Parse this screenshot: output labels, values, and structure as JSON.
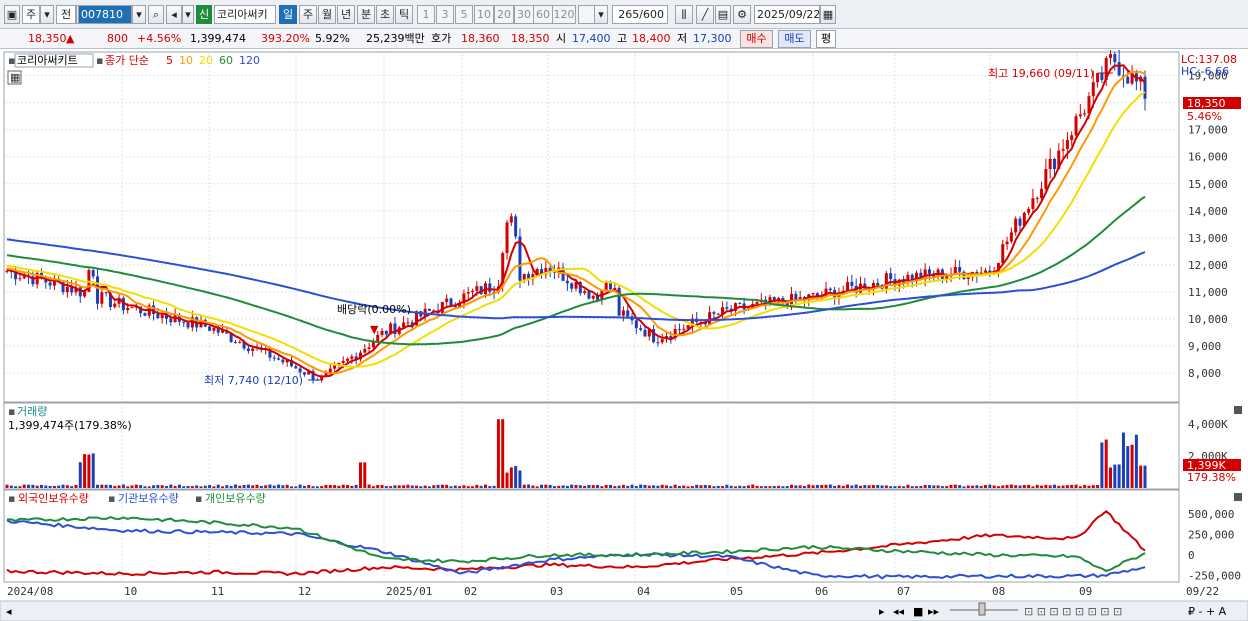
{
  "toolbar": {
    "mode": "주",
    "jeon": "전",
    "code": "007810",
    "badge": "신",
    "name": "코리아써키",
    "periods": [
      "일",
      "주",
      "월",
      "년",
      "분",
      "초",
      "틱"
    ],
    "minutes": [
      "1",
      "3",
      "5",
      "10",
      "20",
      "30",
      "60",
      "120"
    ],
    "count": "265/600",
    "date": "2025/09/22"
  },
  "quote": {
    "price": "18,350",
    "arrow": "▲",
    "change": "800",
    "change_pct": "+4.56%",
    "volume": "1,399,474",
    "volume_ratio": "393.20%",
    "turnover_pct": "5.92%",
    "trade_value": "25,239백만",
    "hoga_label": "호가",
    "ask": "18,360",
    "bid": "18,350",
    "open_label": "시",
    "open": "17,400",
    "high_label": "고",
    "high": "18,400",
    "low_label": "저",
    "low": "17,300",
    "buy": "매수",
    "sell": "매도",
    "avg": "평"
  },
  "price_panel": {
    "title": "코리아써키트",
    "ma_title": "종가 단순",
    "ma_periods": [
      {
        "p": "5",
        "color": "#d40000"
      },
      {
        "p": "10",
        "color": "#ff9900"
      },
      {
        "p": "20",
        "color": "#f0e000"
      },
      {
        "p": "60",
        "color": "#1e8c3a"
      },
      {
        "p": "120",
        "color": "#2c4fd4"
      }
    ],
    "lc": "LC:137.08",
    "hc": "HC:-6.66",
    "current_tag": "18,350",
    "current_pct": "5.46%",
    "y_ticks": [
      "19,000",
      "18,000",
      "17,000",
      "16,000",
      "15,000",
      "14,000",
      "13,000",
      "12,000",
      "11,000",
      "10,000",
      "9,000",
      "8,000"
    ],
    "high_annotation": "최고 19,660 (09/11)",
    "low_annotation": "최저 7,740 (12/10)",
    "dividend_annotation": "배당락(0.00%)"
  },
  "volume_panel": {
    "title": "거래량",
    "value": "1,399,474주(179.38%)",
    "y_ticks": [
      "4,000K",
      "2,000K"
    ],
    "current_tag": "1,399K",
    "current_pct": "179.38%"
  },
  "holdings_panel": {
    "series": [
      "외국인보유수량",
      "기관보유수량",
      "개인보유수량"
    ],
    "colors": [
      "#d40000",
      "#2c4fd4",
      "#1e8c3a"
    ],
    "y_ticks": [
      "500,000",
      "250,000",
      "0",
      "-250,000"
    ]
  },
  "x_axis": [
    "2024/08",
    "10",
    "11",
    "12",
    "2025/01",
    "02",
    "03",
    "04",
    "05",
    "06",
    "07",
    "08",
    "09",
    "09/22"
  ],
  "chart_data": [
    {
      "type": "candlestick",
      "title": "코리아써키트",
      "unit": "KRW",
      "ylim": [
        7000,
        19800
      ],
      "anchors_x": [
        "2024/08",
        "2024/09",
        "2024/10",
        "2024/11",
        "2024/12/10",
        "2025/01",
        "2025/02",
        "2025/03",
        "2025/04",
        "2025/05",
        "2025/06",
        "2025/07",
        "2025/08",
        "2025/09/11",
        "2025/09/22"
      ],
      "anchors_close": [
        11800,
        11200,
        10500,
        9700,
        7740,
        9500,
        10800,
        12000,
        9300,
        10300,
        10800,
        11500,
        11800,
        19660,
        18350
      ]
    },
    {
      "type": "bar",
      "title": "거래량",
      "unit": "K shares",
      "current": 1399
    },
    {
      "type": "line",
      "series": [
        {
          "name": "외국인보유수량",
          "values": [
            -200000,
            -230000,
            -210000,
            -230000,
            -150000,
            -180000,
            -120000,
            -150000,
            -50000,
            20000,
            120000,
            240000,
            200000,
            550000,
            50000
          ]
        },
        {
          "name": "기관보유수량",
          "values": [
            420000,
            300000,
            280000,
            260000,
            40000,
            -230000,
            -60000,
            10000,
            -20000,
            -250000,
            -270000,
            -260000,
            -260000,
            -250000,
            -150000
          ]
        },
        {
          "name": "개인보유수량",
          "values": [
            420000,
            460000,
            400000,
            330000,
            -50000,
            -80000,
            0,
            0,
            40000,
            100000,
            50000,
            0,
            -20000,
            -200000,
            20000
          ]
        }
      ]
    }
  ]
}
